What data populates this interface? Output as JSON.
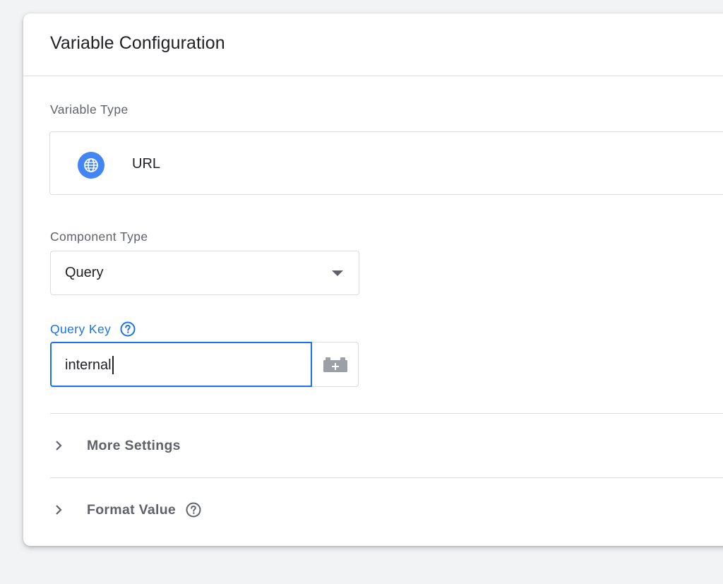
{
  "card": {
    "title": "Variable Configuration"
  },
  "variable_type": {
    "label": "Variable Type",
    "icon": "globe-icon",
    "value": "URL"
  },
  "component_type": {
    "label": "Component Type",
    "selected": "Query"
  },
  "query_key": {
    "label": "Query Key",
    "value": "internal"
  },
  "sections": {
    "more_settings": "More Settings",
    "format_value": "Format Value"
  },
  "colors": {
    "accent": "#1a73e8",
    "globe_bg": "#4285f4",
    "muted_text": "#5f6368",
    "border": "#dadce0"
  }
}
